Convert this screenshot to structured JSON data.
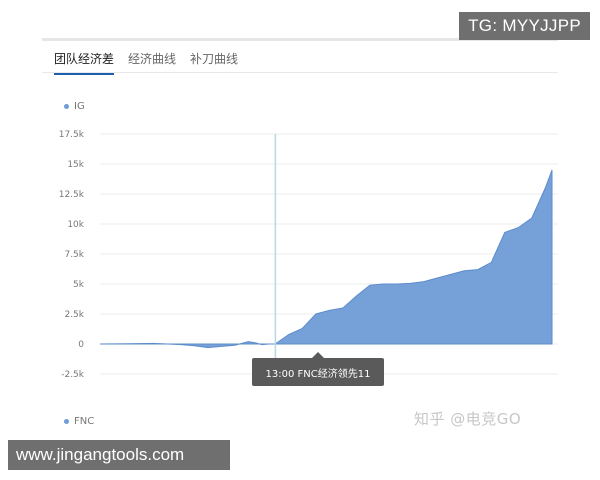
{
  "overlay": {
    "tg_text": "TG: MYYJJPP",
    "url_text": "www.jingangtools.com",
    "watermark": "知乎 @电竞GO"
  },
  "tabs": [
    {
      "label": "团队经济差",
      "active": true
    },
    {
      "label": "经济曲线",
      "active": false
    },
    {
      "label": "补刀曲线",
      "active": false
    }
  ],
  "legend": {
    "top": "IG",
    "bottom": "FNC",
    "accent": "#6f9bd6"
  },
  "tooltip": {
    "text": "13:00 FNC经济领先11"
  },
  "chart_data": {
    "type": "area",
    "title": "",
    "xlabel": "",
    "ylabel": "",
    "ylim": [
      -2500,
      17500
    ],
    "y_ticks": [
      "17.5k",
      "15k",
      "12.5k",
      "10k",
      "7.5k",
      "5k",
      "2.5k",
      "0",
      "-2.5k"
    ],
    "grid": true,
    "fill_color": "#6f9bd6",
    "cursor_minute": 13,
    "series": [
      {
        "x": [
          0,
          2,
          4,
          6,
          7,
          8,
          9,
          10,
          11,
          11.5,
          12,
          12.5,
          13,
          14,
          15,
          16,
          17,
          18,
          19,
          20,
          21,
          22,
          23,
          24,
          25,
          26,
          27,
          28,
          29,
          30,
          31,
          32,
          33,
          33.5
        ],
        "values": [
          0,
          20,
          50,
          -50,
          -150,
          -300,
          -200,
          -100,
          200,
          100,
          -50,
          0,
          10,
          800,
          1300,
          2500,
          2800,
          3000,
          4000,
          4900,
          5000,
          5000,
          5050,
          5200,
          5500,
          5800,
          6100,
          6200,
          6800,
          9300,
          9700,
          10500,
          13000,
          14500
        ]
      }
    ]
  }
}
